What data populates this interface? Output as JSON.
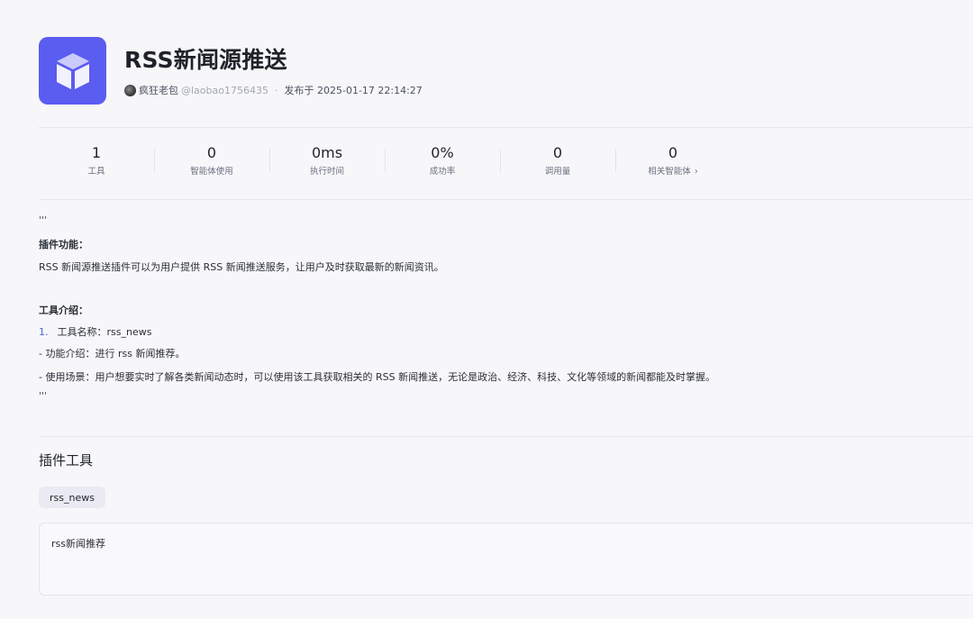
{
  "plugin": {
    "icon": "cube-icon",
    "icon_bg": "#5b5cf0",
    "title": "RSS新闻源推送",
    "author": "疯狂老包",
    "handle": "@laobao1756435",
    "separator": "·",
    "published": "发布于 2025-01-17 22:14:27"
  },
  "stats": [
    {
      "value": "1",
      "label": "工具"
    },
    {
      "value": "0",
      "label": "智能体使用"
    },
    {
      "value": "0ms",
      "label": "执行时间"
    },
    {
      "value": "0%",
      "label": "成功率"
    },
    {
      "value": "0",
      "label": "调用量"
    },
    {
      "value": "0",
      "label": "相关智能体",
      "chevron": "›"
    }
  ],
  "description": {
    "open_quote": "'''",
    "function_heading": "插件功能：",
    "function_text": "RSS 新闻源推送插件可以为用户提供 RSS 新闻推送服务，让用户及时获取最新的新闻资讯。",
    "tools_heading": "工具介绍：",
    "tool_number": "1.",
    "tool_name": "工具名称：rss_news",
    "tool_intro": " - 功能介绍：进行 rss 新闻推荐。",
    "tool_scenario": " - 使用场景：用户想要实时了解各类新闻动态时，可以使用该工具获取相关的 RSS 新闻推送，无论是政治、经济、科技、文化等领域的新闻都能及时掌握。",
    "close_quote": "'''"
  },
  "tools_section": {
    "title": "插件工具",
    "active_tool": "rss_news",
    "tool_description": "rss新闻推荐"
  }
}
